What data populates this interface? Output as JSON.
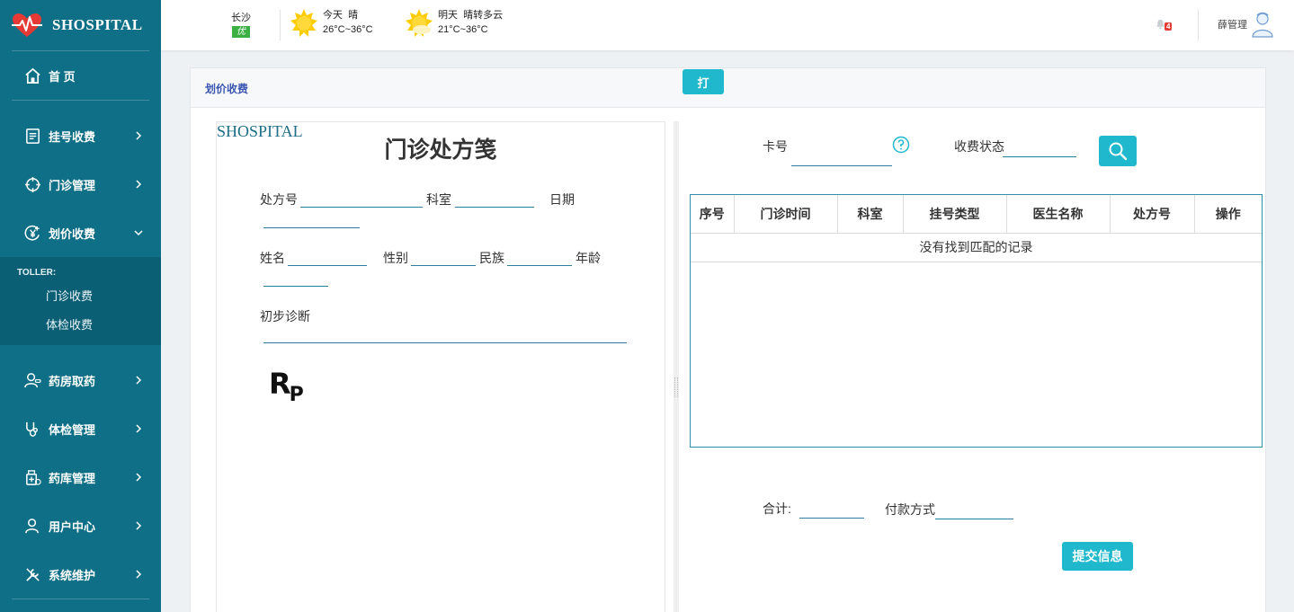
{
  "brand": {
    "name": "SHOSPITAL"
  },
  "sidebar": {
    "home": "首 页",
    "items": [
      {
        "label": "挂号收费"
      },
      {
        "label": "门诊管理"
      },
      {
        "label": "划价收费"
      }
    ],
    "submenu": {
      "title": "TOLLER:",
      "items": [
        "门诊收费",
        "体检收费"
      ]
    },
    "items2": [
      {
        "label": "药房取药"
      },
      {
        "label": "体检管理"
      },
      {
        "label": "药库管理"
      },
      {
        "label": "用户中心"
      },
      {
        "label": "系统维护"
      }
    ]
  },
  "header": {
    "city": "长沙",
    "aqi": "优",
    "today": {
      "label": "今天",
      "cond": "晴",
      "temp": "26°C~36°C"
    },
    "tomorrow": {
      "label": "明天",
      "cond": "晴转多云",
      "temp": "21°C~36°C"
    },
    "notifications": "4",
    "user": "薛管理"
  },
  "panel": {
    "title": "划价收费",
    "print_label": "打"
  },
  "prescription": {
    "brand": "SHOSPITAL",
    "title": "门诊处方笺",
    "labels": {
      "rx_no": "处方号",
      "dept": "科室",
      "date": "日期",
      "name": "姓名",
      "gender": "性别",
      "ethnic": "民族",
      "age": "年龄",
      "diagnosis": "初步诊断"
    },
    "rp": "R",
    "rp_sub": "P"
  },
  "query": {
    "card_label": "卡号",
    "status_label": "收费状态"
  },
  "table": {
    "headers": [
      "序号",
      "门诊时间",
      "科室",
      "挂号类型",
      "医生名称",
      "处方号",
      "操作"
    ],
    "empty": "没有找到匹配的记录"
  },
  "footer": {
    "total_label": "合计:",
    "pay_label": "付款方式",
    "submit_label": "提交信息"
  },
  "colors": {
    "sidebar": "#0e6f86",
    "accent": "#1fb8cc",
    "title": "#3a56b0"
  }
}
